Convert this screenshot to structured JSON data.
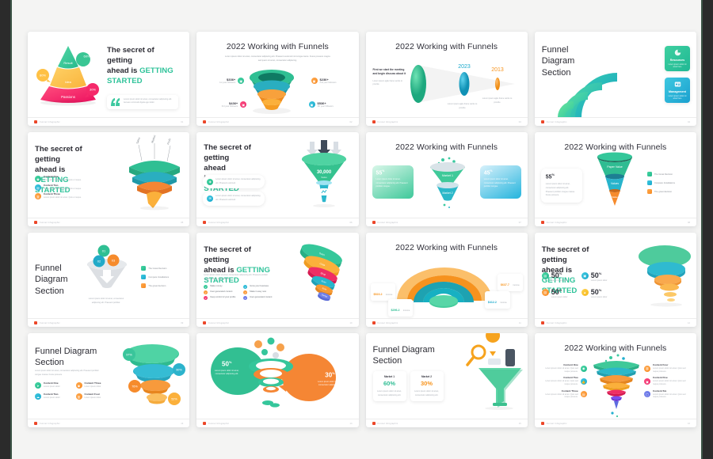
{
  "frame": {
    "accent_color": "#3c5446",
    "bar_color": "#2b2b2b",
    "page_bg": "#f4f4f3"
  },
  "brand": {
    "footer_text": "Funnel Infographic",
    "accent_green": "#2fc39a",
    "accent_orange": "#f7941e",
    "accent_pink": "#ed1e63",
    "accent_blue": "#1aa9cc"
  },
  "common": {
    "headline_part1": "The secret of getting",
    "headline_part2": "ahead is ",
    "headline_accent": "GETTING STARTED",
    "title_2022": "2022 Working with Funnels",
    "title_funnel_section": "Funnel Diagram Section",
    "lorem_short": "Lorem ipsum dolor sit amet, consectetur adipiscing elit.",
    "lorem_long": "Lorem ipsum dolor sit amet, consectetur adipiscing elit. Praesent euismod nisl congue lacus. Fusce posuere magna sed quam sit amet, consectetur adipiscing elit.",
    "lorem_mid": "Lorem ipsum dolor sit amet, consectetur adipiscing elit. Praesent porttitor."
  },
  "slides": [
    {
      "id": "s1",
      "page": "01",
      "layout": "pyramid",
      "headline1": "The secret of getting",
      "headline2": "ahead is ",
      "headline_accent": "GETTING STARTED",
      "quote": "Lorem ipsum dolor sit amet, consectetur adipiscing elit. Aenean commodo ligula eget dolor.",
      "pyramid": [
        {
          "label": "Result",
          "badge": "60%",
          "color": "#39c694"
        },
        {
          "label": "Idea",
          "badge": "80%",
          "color": "#ffc145"
        },
        {
          "label": "Passions",
          "badge": "30%",
          "color": "#f5296a"
        }
      ]
    },
    {
      "id": "s2",
      "page": "02",
      "layout": "ring-funnel",
      "title": "2022 Working with Funnels",
      "subtitle": "Lorem ipsum dolor sit amet, consectetur adipiscing elit. Praesent euismod nisl congue lacus. Fusce posuere magna sed quam sit amet, consectetur adipiscing.",
      "stats": [
        {
          "value": "$336+",
          "caption": "1st year followers",
          "color": "#2ebd93",
          "side": "left"
        },
        {
          "value": "$236+",
          "caption": "2nd year followers",
          "color": "#f7941e",
          "side": "right"
        },
        {
          "value": "$436+",
          "caption": "3rd year followers",
          "color": "#ed1e63",
          "side": "left"
        },
        {
          "value": "$536+",
          "caption": "4th year followers",
          "color": "#1aa9cc",
          "side": "right"
        }
      ]
    },
    {
      "id": "s3",
      "page": "03",
      "layout": "cone-timeline",
      "title": "2022 Working with Funnels",
      "lead": "First we start the meeting and begin discuss about it",
      "lead_sub": "Lorem ipsum agile frame works to provide",
      "markers": [
        {
          "year": "2023",
          "color": "#19a9cc",
          "caption": "Lorem ipsum agile frame works to provide"
        },
        {
          "year": "2013",
          "color": "#f7941e",
          "caption": "Lorem ipsum agile frame works to provide"
        }
      ]
    },
    {
      "id": "s4",
      "page": "04",
      "layout": "arcs",
      "title1": "Funnel",
      "title2": "Diagram",
      "title3": "Section",
      "cards": [
        {
          "label": "Resources",
          "caption": "Lorem ipsum dolor sit amet here",
          "icon": "pie-chart-icon",
          "color": "#2ebd93"
        },
        {
          "label": "Management",
          "caption": "Lorem ipsum dolor sit amet here",
          "icon": "id-card-icon",
          "color": "#1aa9cc"
        }
      ]
    },
    {
      "id": "s5",
      "page": "05",
      "layout": "spiral-ribbon",
      "headline1": "The secret of getting",
      "headline2": "ahead is ",
      "headline_accent": "GETTING STARTED",
      "items": [
        {
          "title": "Content One",
          "text": "Lorem ipsum dolor sit amet. Quis et neque.",
          "color": "g",
          "icon": "camera-icon"
        },
        {
          "title": "Content Two",
          "text": "Lorem ipsum dolor sit amet. Quis et neque.",
          "color": "b",
          "icon": "briefcase-icon"
        },
        {
          "title": "Content Three",
          "text": "Lorem ipsum dolor sit amet. Quis et neque.",
          "color": "o",
          "icon": "archive-icon"
        }
      ],
      "ribbon_labels": [
        "Sales",
        "Market",
        "Profit"
      ]
    },
    {
      "id": "s6",
      "page": "06",
      "layout": "inverted-cone",
      "headline1": "The secret of",
      "headline2": "getting ahead",
      "headline3": "is ",
      "headline_accent": "GETTING STARTED",
      "cards": [
        {
          "text": "Lorem ipsum dolor sit amet, consectetur adipiscing elit. Praesent euismod.",
          "color": "g",
          "icon": "megaphone-icon"
        },
        {
          "text": "Lorem ipsum dolor sit amet, consectetur adipiscing elit. Praesent euismod.",
          "color": "b",
          "icon": "mail-icon"
        }
      ],
      "funnel_value": "30,000",
      "funnel_label": "Sales"
    },
    {
      "id": "s7",
      "page": "07",
      "layout": "two-market",
      "title": "2022 Working with Funnels",
      "left": {
        "value": "55",
        "unit": "%",
        "text": "Lorem ipsum dolor sit amet, consectetur adipiscing elit. Praesent porttitor congue.",
        "color": "#35c88f"
      },
      "right": {
        "value": "45",
        "unit": "%",
        "text": "Lorem ipsum dolor sit amet, consectetur adipiscing elit. Praesent porttitor congue.",
        "color": "#21b6dd"
      },
      "funnel_labels": [
        "Market 1",
        "Market 2"
      ]
    },
    {
      "id": "s8",
      "page": "08",
      "layout": "cone-legend",
      "title": "2022 Working with Funnels",
      "stat": {
        "value": "55",
        "unit": "%",
        "text": "Lorem ipsum dolor sit amet, consectetur adipiscing elit. Praesent porttitor congue massa. Fusce posuere."
      },
      "funnel_labels": [
        "Paper Value",
        "Values",
        "Value"
      ],
      "legend": [
        {
          "label": "The Great Decision",
          "color": "g"
        },
        {
          "label": "Compare Installations",
          "color": "b"
        },
        {
          "label": "The great decision",
          "color": "o"
        }
      ]
    },
    {
      "id": "s9",
      "page": "09",
      "layout": "balls-funnel",
      "title1": "Funnel",
      "title2": "Diagram",
      "title3": "Section",
      "balls": [
        {
          "num": "01",
          "color": "g"
        },
        {
          "num": "02",
          "color": "b"
        },
        {
          "num": "03",
          "color": "o"
        }
      ],
      "caption": "Lorem ipsum dolor sit amet, consectetur adipiscing elit. Praesent porttitor.",
      "legend": [
        {
          "label": "The Great Decision",
          "color": "g"
        },
        {
          "label": "Compare Installations",
          "color": "b"
        },
        {
          "label": "The great decision",
          "color": "o"
        }
      ]
    },
    {
      "id": "s10",
      "page": "10",
      "layout": "stack-6",
      "headline1": "The secret of getting",
      "headline2": "ahead is ",
      "headline_accent": "GETTING STARTED",
      "body": "Lorem ipsum dolor sit amet, consectetur adipiscing elit. Praesent porttitor congue massa. Fusce posuere.",
      "items": [
        {
          "label": "Make money",
          "color": "g"
        },
        {
          "label": "Grow your business",
          "color": "b"
        },
        {
          "label": "User generated content",
          "color": "o"
        },
        {
          "label": "Make it easy now",
          "color": "o"
        },
        {
          "label": "Keep control of your profits",
          "color": "p"
        },
        {
          "label": "User generated content",
          "color": "v"
        }
      ],
      "stack_labels": [
        "Scan",
        "Cube",
        "Shop",
        "Scan",
        "Scan",
        "Startup"
      ]
    },
    {
      "id": "s11",
      "page": "11",
      "layout": "rings-3d",
      "title": "2022 Working with Funnels",
      "stats": [
        {
          "value": "$637.7",
          "caption": "income",
          "color": "#f7941e"
        },
        {
          "value": "$523.2",
          "caption": "income",
          "color": "#f7941e"
        },
        {
          "value": "$412.2",
          "caption": "income",
          "color": "#1aa9cc"
        },
        {
          "value": "$296.2",
          "caption": "income",
          "color": "#2ebd93"
        }
      ]
    },
    {
      "id": "s12",
      "page": "12",
      "layout": "four-50",
      "headline1": "The secret of getting",
      "headline2": "ahead is ",
      "headline_accent": "GETTING STARTED",
      "stats": [
        {
          "value": "50",
          "unit": "%",
          "caption": "Lorem ipsum dolor",
          "color": "g",
          "icon": "briefcase-icon"
        },
        {
          "value": "50",
          "unit": "%",
          "caption": "Lorem ipsum dolor",
          "color": "b",
          "icon": "monitor-icon"
        },
        {
          "value": "50",
          "unit": "%",
          "caption": "Lorem ipsum dolor",
          "color": "o",
          "icon": "box-icon"
        },
        {
          "value": "50",
          "unit": "%",
          "caption": "Lorem ipsum dolor",
          "color": "y",
          "icon": "alert-icon"
        }
      ]
    },
    {
      "id": "s13",
      "page": "13",
      "layout": "bowls",
      "title1": "Funnel Diagram",
      "title2": "Section",
      "body": "Lorem ipsum dolor sit amet, consectetur adipiscing elit. Praesent porttitor congue massa. Fusce posuere.",
      "items": [
        {
          "title": "Content One",
          "text": "Lorem ipsum dolor",
          "color": "g",
          "icon": "send-icon"
        },
        {
          "title": "Content Three",
          "text": "Lorem ipsum dolor",
          "color": "o",
          "icon": "camera-icon"
        },
        {
          "title": "Content Two",
          "text": "Lorem ipsum dolor",
          "color": "b",
          "icon": "cloud-icon"
        },
        {
          "title": "Content Four",
          "text": "Lorem ipsum dolor",
          "color": "o",
          "icon": "archive-icon"
        }
      ],
      "badges": [
        "97%",
        "90%",
        "76%",
        "52%"
      ]
    },
    {
      "id": "s14",
      "page": "14",
      "layout": "bubbles",
      "left": {
        "value": "50",
        "unit": "%",
        "text": "Lorem ipsum dolor sit amet, consectetur adipiscing elit.",
        "color": "#2ebd93"
      },
      "right": {
        "value": "30",
        "unit": "%",
        "text": "Lorem ipsum dolor sit amet, consectetur adipiscing elit.",
        "color": "#f58634"
      }
    },
    {
      "id": "s15",
      "page": "15",
      "layout": "funnel-illustration",
      "title1": "Funnel Diagram",
      "title2": "Section",
      "cards": [
        {
          "label": "Market 1",
          "value": "60%",
          "text": "Lorem ipsum dolor sit amet, consectetur adipiscing elit.",
          "color": "#2ebd93"
        },
        {
          "label": "Market 2",
          "value": "30%",
          "text": "Lorem ipsum dolor sit amet, consectetur adipiscing elit.",
          "color": "#f7941e"
        }
      ]
    },
    {
      "id": "s16",
      "page": "16",
      "layout": "spiral-6",
      "title": "2022 Working with Funnels",
      "items_left": [
        {
          "title": "Content One",
          "text": "Lorem ipsum dolor sit amet. Quis sed neque posuere.",
          "color": "g",
          "icon": "camera-icon"
        },
        {
          "title": "Content Two",
          "text": "Lorem ipsum dolor sit amet. Quis sed neque posuere.",
          "color": "b",
          "icon": "thumbs-up-icon"
        },
        {
          "title": "Content Three",
          "text": "Lorem ipsum dolor sit amet. Quis sed neque posuere.",
          "color": "o",
          "icon": "briefcase-icon"
        }
      ],
      "items_right": [
        {
          "title": "Content Four",
          "text": "Lorem ipsum dolor sit amet. Quis sed neque posuere.",
          "color": "o",
          "icon": "archive-icon"
        },
        {
          "title": "Content Five",
          "text": "Lorem ipsum dolor sit amet. Quis sed neque posuere.",
          "color": "p",
          "icon": "box-icon"
        },
        {
          "title": "Content Six",
          "text": "Lorem ipsum dolor sit amet. Quis sed neque posuere.",
          "color": "v",
          "icon": "monitor-icon"
        }
      ]
    }
  ]
}
